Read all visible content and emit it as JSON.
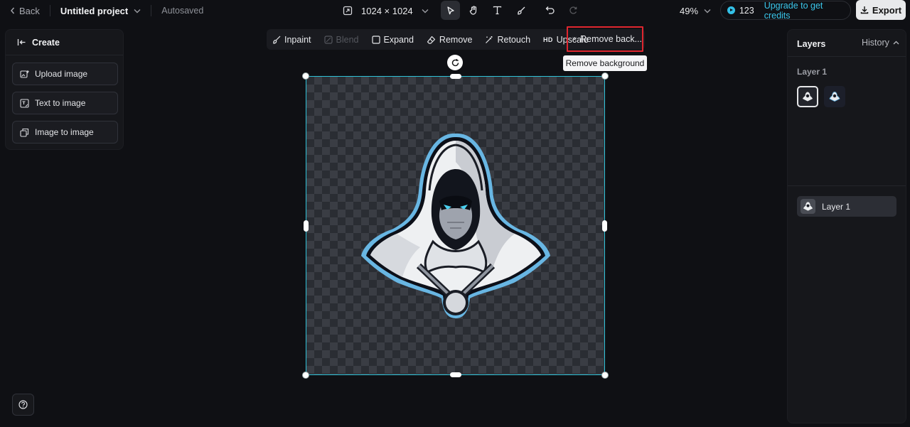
{
  "topbar": {
    "back_label": "Back",
    "project_title": "Untitled project",
    "save_status": "Autosaved",
    "canvas_size": "1024 × 1024",
    "zoom": "49%",
    "credits": "123",
    "upgrade_label": "Upgrade to get credits",
    "export_label": "Export",
    "tool_icons": [
      "select-icon",
      "hand-icon",
      "text-icon",
      "brush-icon",
      "undo-icon",
      "redo-icon"
    ]
  },
  "left_panel": {
    "title": "Create",
    "items": [
      {
        "label": "Upload image",
        "icon": "upload-image-icon"
      },
      {
        "label": "Text to image",
        "icon": "text-to-image-icon"
      },
      {
        "label": "Image to image",
        "icon": "image-to-image-icon"
      }
    ]
  },
  "edit_toolbar": {
    "items": [
      {
        "label": "Inpaint",
        "icon": "inpaint-icon",
        "disabled": false
      },
      {
        "label": "Blend",
        "icon": "blend-icon",
        "disabled": true
      },
      {
        "label": "Expand",
        "icon": "expand-icon",
        "disabled": false
      },
      {
        "label": "Remove",
        "icon": "eraser-icon",
        "disabled": false
      },
      {
        "label": "Retouch",
        "icon": "retouch-icon",
        "disabled": false
      },
      {
        "label": "Upscale",
        "icon": "hd-icon",
        "disabled": false
      },
      {
        "label": "Remove back...",
        "icon": "remove-background-icon",
        "disabled": false
      }
    ],
    "upscale_badge": "HD",
    "tooltip": "Remove background"
  },
  "right_panel": {
    "title": "Layers",
    "history_label": "History",
    "layer_group_label": "Layer 1",
    "layers": [
      {
        "label": "Layer 1"
      }
    ]
  },
  "colors": {
    "accent": "#2fc2d8",
    "highlight": "#e0262f",
    "background": "#0f1014"
  }
}
